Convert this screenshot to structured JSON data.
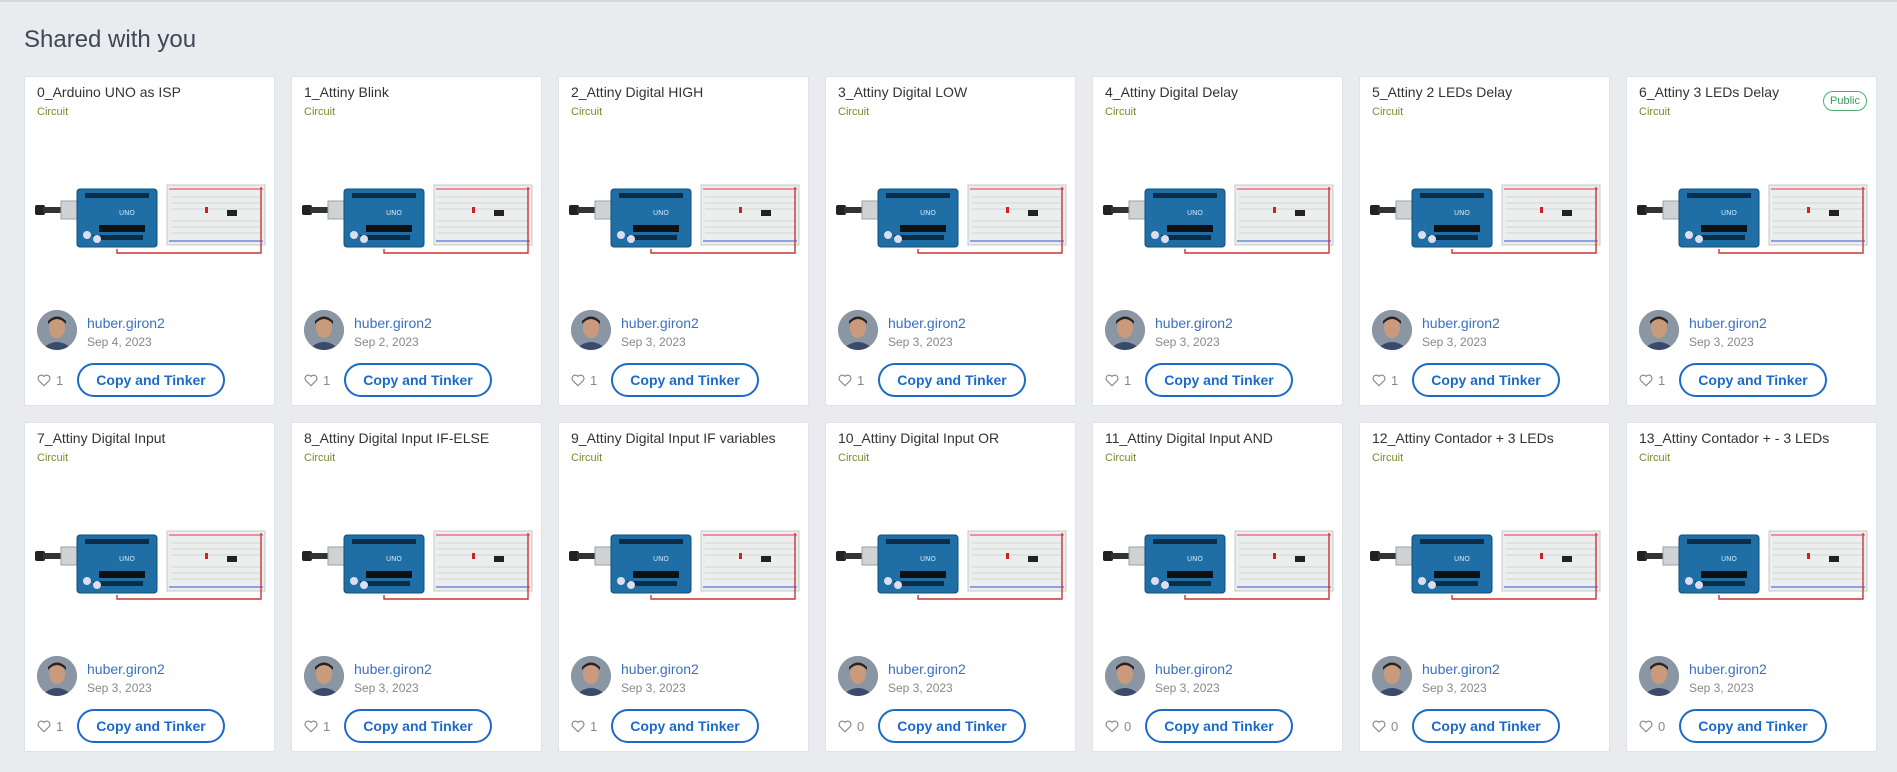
{
  "section_title": "Shared with you",
  "colors": {
    "link": "#3a6fc4",
    "button": "#1b6ac9",
    "circuit_tag": "#7a8a2a",
    "public_badge": "#3b9a5d"
  },
  "cards": [
    {
      "title": "0_Arduino UNO as ISP",
      "type": "Circuit",
      "author": "huber.giron2",
      "date": "Sep 4, 2023",
      "likes": "1",
      "button": "Copy and Tinker",
      "badge": ""
    },
    {
      "title": "1_Attiny Blink",
      "type": "Circuit",
      "author": "huber.giron2",
      "date": "Sep 2, 2023",
      "likes": "1",
      "button": "Copy and Tinker",
      "badge": ""
    },
    {
      "title": "2_Attiny Digital HIGH",
      "type": "Circuit",
      "author": "huber.giron2",
      "date": "Sep 3, 2023",
      "likes": "1",
      "button": "Copy and Tinker",
      "badge": ""
    },
    {
      "title": "3_Attiny Digital LOW",
      "type": "Circuit",
      "author": "huber.giron2",
      "date": "Sep 3, 2023",
      "likes": "1",
      "button": "Copy and Tinker",
      "badge": ""
    },
    {
      "title": "4_Attiny Digital Delay",
      "type": "Circuit",
      "author": "huber.giron2",
      "date": "Sep 3, 2023",
      "likes": "1",
      "button": "Copy and Tinker",
      "badge": ""
    },
    {
      "title": "5_Attiny 2 LEDs Delay",
      "type": "Circuit",
      "author": "huber.giron2",
      "date": "Sep 3, 2023",
      "likes": "1",
      "button": "Copy and Tinker",
      "badge": ""
    },
    {
      "title": "6_Attiny 3 LEDs Delay",
      "type": "Circuit",
      "author": "huber.giron2",
      "date": "Sep 3, 2023",
      "likes": "1",
      "button": "Copy and Tinker",
      "badge": "Public"
    },
    {
      "title": "7_Attiny Digital Input",
      "type": "Circuit",
      "author": "huber.giron2",
      "date": "Sep 3, 2023",
      "likes": "1",
      "button": "Copy and Tinker",
      "badge": ""
    },
    {
      "title": "8_Attiny Digital Input IF-ELSE",
      "type": "Circuit",
      "author": "huber.giron2",
      "date": "Sep 3, 2023",
      "likes": "1",
      "button": "Copy and Tinker",
      "badge": ""
    },
    {
      "title": "9_Attiny Digital Input IF variables",
      "type": "Circuit",
      "author": "huber.giron2",
      "date": "Sep 3, 2023",
      "likes": "1",
      "button": "Copy and Tinker",
      "badge": ""
    },
    {
      "title": "10_Attiny Digital Input OR",
      "type": "Circuit",
      "author": "huber.giron2",
      "date": "Sep 3, 2023",
      "likes": "0",
      "button": "Copy and Tinker",
      "badge": ""
    },
    {
      "title": "11_Attiny Digital Input AND",
      "type": "Circuit",
      "author": "huber.giron2",
      "date": "Sep 3, 2023",
      "likes": "0",
      "button": "Copy and Tinker",
      "badge": ""
    },
    {
      "title": "12_Attiny Contador + 3 LEDs",
      "type": "Circuit",
      "author": "huber.giron2",
      "date": "Sep 3, 2023",
      "likes": "0",
      "button": "Copy and Tinker",
      "badge": ""
    },
    {
      "title": "13_Attiny Contador + - 3 LEDs",
      "type": "Circuit",
      "author": "huber.giron2",
      "date": "Sep 3, 2023",
      "likes": "0",
      "button": "Copy and Tinker",
      "badge": ""
    }
  ]
}
